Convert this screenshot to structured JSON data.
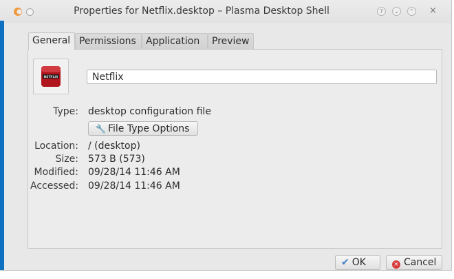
{
  "window": {
    "title": "Properties for Netflix.desktop – Plasma Desktop Shell"
  },
  "tabs": [
    {
      "label": "General",
      "active": true
    },
    {
      "label": "Permissions",
      "active": false
    },
    {
      "label": "Application",
      "active": false
    },
    {
      "label": "Preview",
      "active": false
    }
  ],
  "general": {
    "icon_text": "NETFLIX",
    "name_value": "Netflix",
    "type_label": "Type:",
    "type_value": "desktop configuration file",
    "file_type_button": "File Type Options",
    "location_label": "Location:",
    "location_value": "/ (desktop)",
    "size_label": "Size:",
    "size_value": "573 B (573)",
    "modified_label": "Modified:",
    "modified_value": "09/28/14 11:46 AM",
    "accessed_label": "Accessed:",
    "accessed_value": "09/28/14 11:46 AM"
  },
  "buttons": {
    "ok": "OK",
    "cancel": "Cancel"
  },
  "colors": {
    "accent_blue": "#0f6fc0",
    "netflix_red": "#b0141c"
  }
}
